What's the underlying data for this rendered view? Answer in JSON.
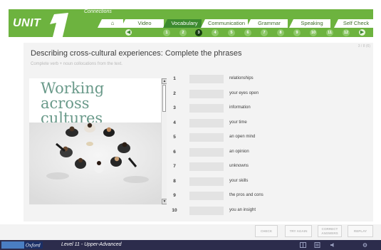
{
  "header": {
    "unit_label": "UNIT",
    "unit_number": "1",
    "subtitle": "Connections",
    "tabs": [
      {
        "label": "Video"
      },
      {
        "label": "Vocabulary"
      },
      {
        "label": "Communication"
      },
      {
        "label": "Grammar"
      },
      {
        "label": "Speaking"
      },
      {
        "label": "Self Check"
      }
    ],
    "home_icon": "home-icon",
    "pages": [
      "1",
      "2",
      "3",
      "4",
      "5",
      "6",
      "7",
      "8",
      "9",
      "10",
      "11",
      "12"
    ],
    "current_page": "3"
  },
  "exercise": {
    "page_count": "3 / 8 (6)",
    "title": "Describing cross-cultural experiences: Complete the phrases",
    "instruction": "Complete verb + noun collocations from the text.",
    "reading_title": [
      "Working",
      "across",
      "cultures"
    ],
    "items": [
      {
        "num": "1",
        "text": "relationships"
      },
      {
        "num": "2",
        "text": "your eyes open"
      },
      {
        "num": "3",
        "text": "information"
      },
      {
        "num": "4",
        "text": "your time"
      },
      {
        "num": "5",
        "text": "an open mind"
      },
      {
        "num": "6",
        "text": "an opinion"
      },
      {
        "num": "7",
        "text": "unknowns"
      },
      {
        "num": "8",
        "text": "your skills"
      },
      {
        "num": "9",
        "text": "the pros and cons"
      },
      {
        "num": "10",
        "text": "you an insight"
      }
    ]
  },
  "actions": {
    "check": "CHECK",
    "try_again": "TRY AGAIN",
    "correct_1": "CORRECT",
    "correct_2": "ANSWERS",
    "replay": "REPLAY"
  },
  "footer": {
    "brand": "Oxford",
    "level": "Level 11 - Upper-Advanced"
  },
  "colors": {
    "brand_green": "#6db33f",
    "active_tab": "#3c8a2e",
    "footer_navy": "#2c2c4c"
  }
}
